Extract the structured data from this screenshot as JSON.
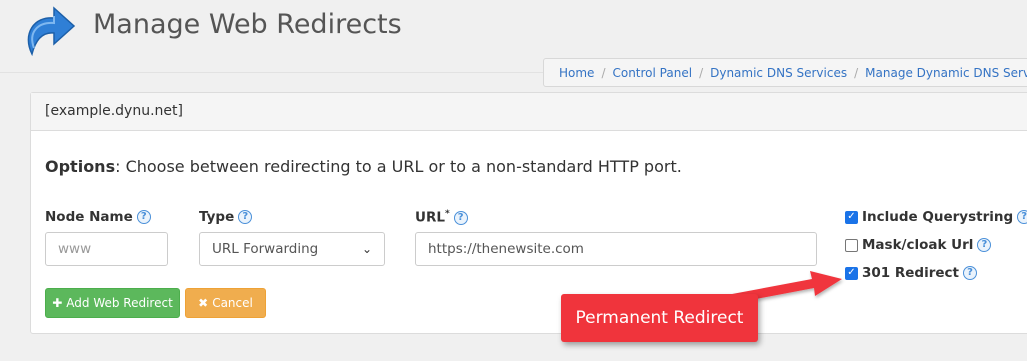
{
  "header": {
    "title": "Manage Web Redirects",
    "logo_icon": "curved-arrow-icon"
  },
  "breadcrumb": [
    "Home",
    "Control Panel",
    "Dynamic DNS Services",
    "Manage Dynamic DNS Service"
  ],
  "panel": {
    "heading": "[example.dynu.net]",
    "options_bold": "Options",
    "options_text": ": Choose between redirecting to a URL or to a non-standard HTTP port."
  },
  "form": {
    "node_name_label": "Node Name",
    "node_name_placeholder": "www",
    "type_label": "Type",
    "type_value": "URL Forwarding",
    "url_label": "URL",
    "url_required_mark": "*",
    "url_value": "https://thenewsite.com",
    "checkboxes": [
      {
        "label": "Include Querystring",
        "checked": true
      },
      {
        "label": "Mask/cloak Url",
        "checked": false
      },
      {
        "label": "301 Redirect",
        "checked": true
      }
    ]
  },
  "buttons": {
    "add_label": "Add Web Redirect",
    "add_icon": "plus-icon",
    "cancel_label": "Cancel",
    "cancel_icon": "x-icon"
  },
  "annotation": {
    "callout_text": "Permanent Redirect",
    "color": "#f0343c"
  },
  "colors": {
    "link": "#3473c4",
    "success": "#5cb85c",
    "warning": "#f0ad4e",
    "help_icon": "#4a90d9"
  }
}
